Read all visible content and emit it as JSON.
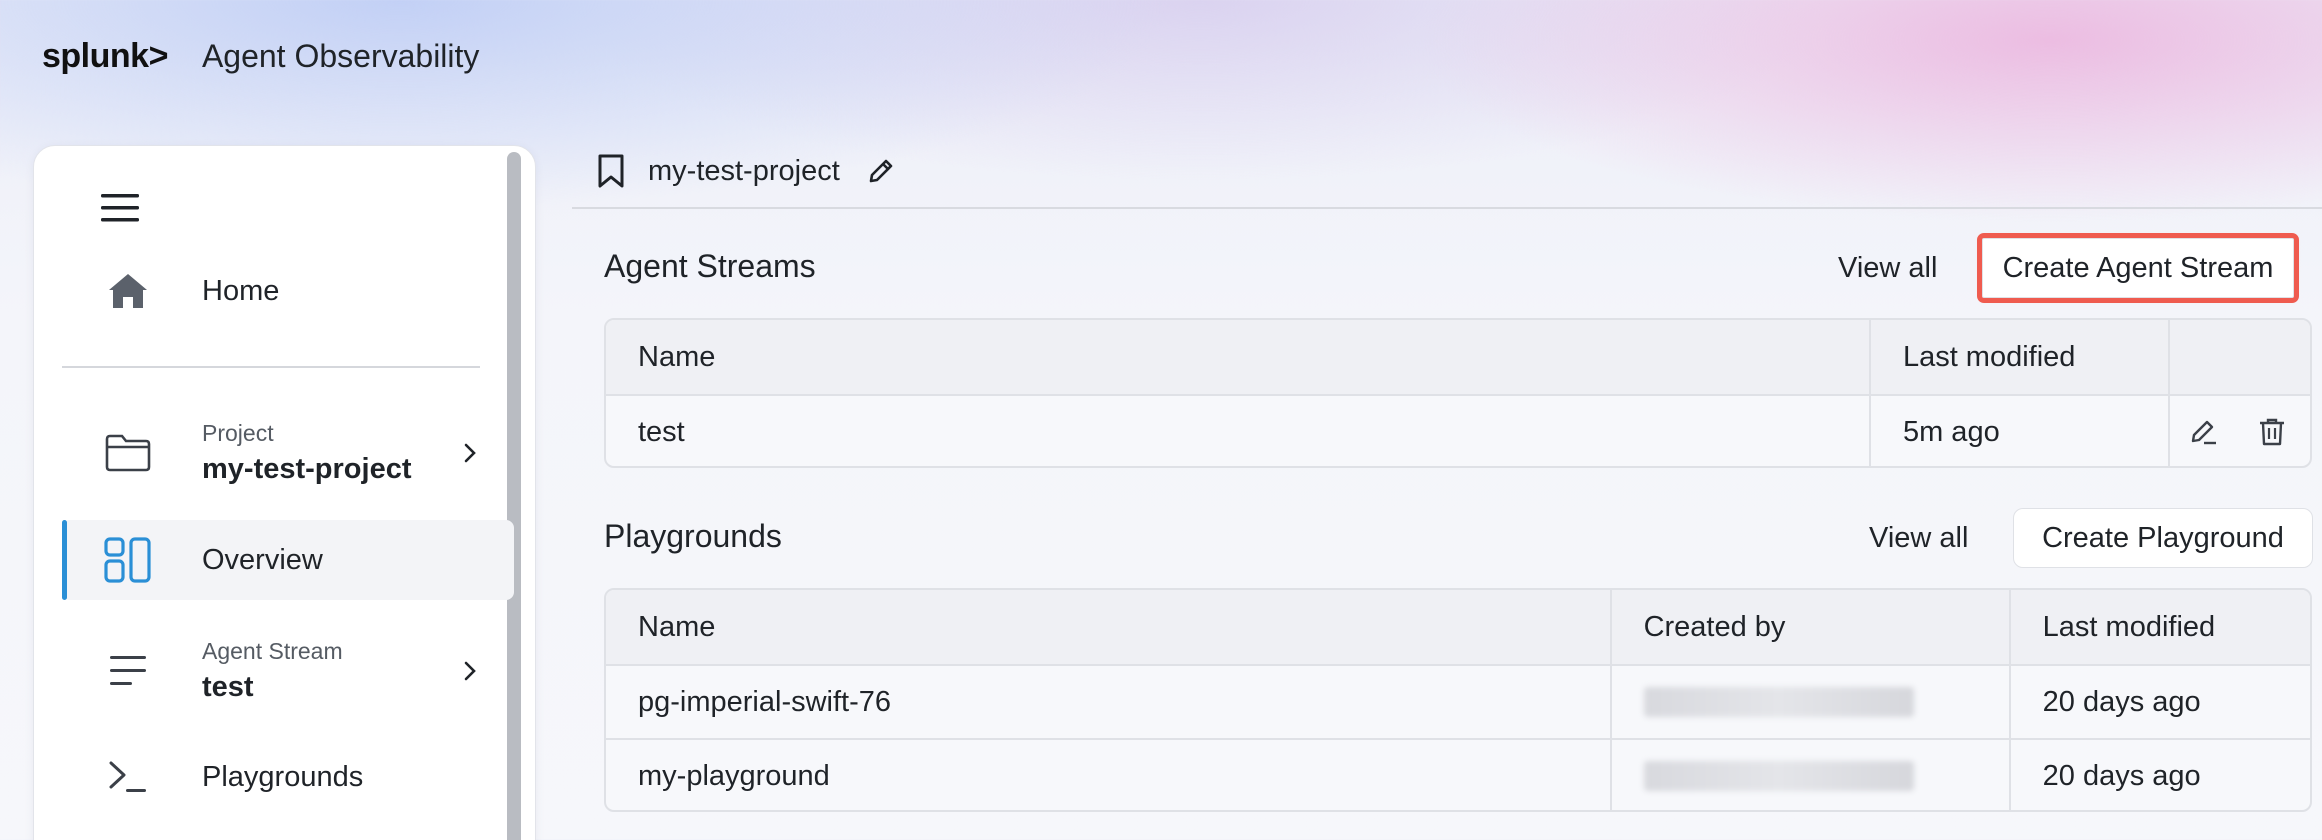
{
  "app": {
    "logo": "splunk>",
    "title": "Agent Observability"
  },
  "sidebar": {
    "home_label": "Home",
    "project": {
      "caption": "Project",
      "value": "my-test-project"
    },
    "overview_label": "Overview",
    "agent_stream": {
      "caption": "Agent Stream",
      "value": "test"
    },
    "playgrounds_label": "Playgrounds"
  },
  "project_bar": {
    "name": "my-test-project"
  },
  "agent_streams": {
    "title": "Agent Streams",
    "view_all": "View all",
    "create_label": "Create Agent Stream",
    "columns": [
      "Name",
      "Last modified"
    ],
    "rows": [
      {
        "name": "test",
        "last_modified": "5m ago"
      }
    ]
  },
  "playgrounds": {
    "title": "Playgrounds",
    "view_all": "View all",
    "create_label": "Create Playground",
    "columns": [
      "Name",
      "Created by",
      "Last modified"
    ],
    "rows": [
      {
        "name": "pg-imperial-swift-76",
        "last_modified": "20 days ago"
      },
      {
        "name": "my-playground",
        "last_modified": "20 days ago"
      }
    ]
  },
  "colors": {
    "accent": "#2a8fd6",
    "highlight": "#ef5b4f"
  }
}
